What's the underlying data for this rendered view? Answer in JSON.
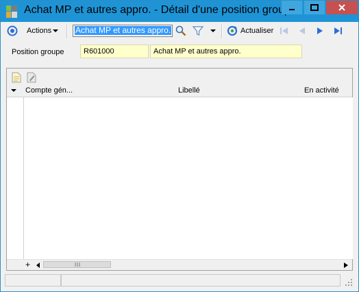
{
  "window": {
    "title": "Achat MP et autres appro. -  Détail d'une position groupe",
    "controls": {
      "minimize": "minimize-icon",
      "maximize": "maximize-icon",
      "close": "close-icon"
    }
  },
  "toolbar": {
    "actions_label": "Actions",
    "search_value": "Achat MP et autres appro.",
    "refresh_label": "Actualiser",
    "icons": [
      "target-icon",
      "search-icon",
      "filter-icon",
      "refresh-icon",
      "first-record-icon",
      "previous-record-icon",
      "next-record-icon",
      "last-record-icon"
    ]
  },
  "form": {
    "position_label": "Position groupe",
    "position_code": "R601000",
    "position_name": "Achat MP et autres appro."
  },
  "grid": {
    "columns": [
      "Compte gén...",
      "Libellé",
      "En activité"
    ],
    "rows": [],
    "scroll_plus": "+"
  },
  "colors": {
    "titlebar": "#1e94d6",
    "close_button": "#c75050",
    "field_background": "#ffffcc",
    "nav_blue": "#2b6fd6",
    "selection": "#3399ff"
  }
}
